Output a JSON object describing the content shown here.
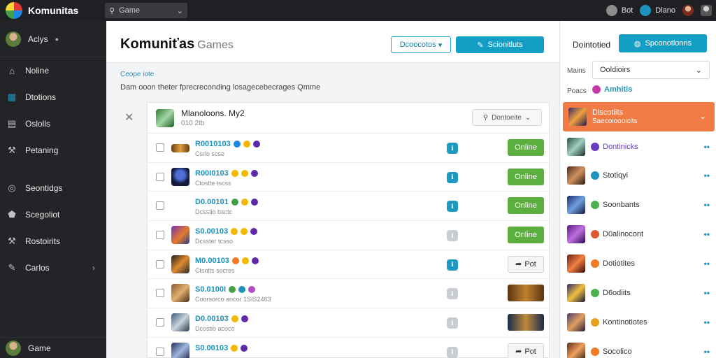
{
  "app": {
    "title": "Komunitas"
  },
  "search": {
    "value": "Game"
  },
  "topbar": {
    "items": [
      {
        "label": "Bot",
        "icon": "headset-icon",
        "color": "#8d8d8d"
      },
      {
        "label": "Dlano",
        "icon": "globe-icon",
        "color": "#1e94bd"
      }
    ]
  },
  "sidebar": {
    "user": "Aclys",
    "items": [
      {
        "label": "Noline",
        "icon": "home-icon"
      },
      {
        "label": "Dtotions",
        "icon": "users-icon"
      },
      {
        "label": "Oslolls",
        "icon": "chat-icon"
      },
      {
        "label": "Petaning",
        "icon": "wrench-icon"
      },
      {
        "label": "Seontidgs",
        "icon": "gauge-icon"
      },
      {
        "label": "Scegoliot",
        "icon": "shield-icon"
      },
      {
        "label": "Rostoirits",
        "icon": "wrench-icon"
      },
      {
        "label": "Carlos",
        "icon": "tool-icon"
      }
    ],
    "bottom_label": "Game"
  },
  "header": {
    "title": "Komuniťas",
    "subtitle": "Games",
    "outline_button": "Dcoocotos",
    "primary_button": "Scionitluts"
  },
  "breadcrumb": "Ceope iote",
  "description": "Dam ooon theter fprecreconding losagecebecrages Qmme",
  "table": {
    "header": {
      "title": "Mlanoloons. My2",
      "subtitle": "010 2tb",
      "filter_label": "Dontoeite"
    },
    "rows": [
      {
        "name": "R0010103",
        "sub": "Csrlo scse",
        "status": "Online",
        "status_type": "online",
        "pill_color": "#1e9ac2"
      },
      {
        "name": "R00I0103",
        "sub": "Ctostte tscss",
        "status": "Online",
        "status_type": "online",
        "pill_color": "#1e9ac2"
      },
      {
        "name": "D0.00101",
        "sub": "Dcsstio bsctc",
        "status": "Online",
        "status_type": "online",
        "pill_color": "#1e9ac2"
      },
      {
        "name": "S0.00103",
        "sub": "Dcsster tcsso",
        "status": "Online",
        "status_type": "online",
        "pill_color": "#c9cdd2"
      },
      {
        "name": "M0.00103",
        "sub": "Ctsnlts socres",
        "status": "Pot",
        "status_type": "post",
        "pill_color": "#1e9ac2"
      },
      {
        "name": "S0.0100I",
        "sub": "Coorsorco ancor 1SIS2463",
        "status": "banner",
        "status_type": "banner",
        "pill_color": "#c9cdd2"
      },
      {
        "name": "D0.00103",
        "sub": "Dcostio acoco",
        "status": "banner",
        "status_type": "banner",
        "pill_color": "#c9cdd2"
      },
      {
        "name": "S0.00103",
        "sub": "",
        "status": "Pot",
        "status_type": "post",
        "pill_color": "#c9cdd2"
      }
    ]
  },
  "right_panel": {
    "header": "Dointotied",
    "button": "Spconotlonns",
    "label_main": "Mains",
    "select_value": "Ooldioirs",
    "label_filter": "Poacs",
    "filter_value": "Amhitis",
    "active": {
      "title": "Dlscotiits",
      "subtitle": "Saecoioooicits"
    },
    "items": [
      {
        "label": "Dontinicks",
        "icon_color": "#6a3cc4"
      },
      {
        "label": "Stotiqyi",
        "icon_color": "#1e94bd"
      },
      {
        "label": "Soonbants",
        "icon_color": "#4caf50"
      },
      {
        "label": "D0alinocont",
        "icon_color": "#e0582f"
      },
      {
        "label": "Dotiotites",
        "icon_color": "#f07b20"
      },
      {
        "label": "D6odiits",
        "icon_color": "#4caf50"
      },
      {
        "label": "Kontinotiotes",
        "icon_color": "#e5a21d"
      },
      {
        "label": "Socolico",
        "icon_color": "#f07b20"
      }
    ]
  },
  "colors": {
    "accent": "#139ec4",
    "online": "#5cae3e",
    "highlight": "#f07b45",
    "sidebar": "#232427"
  }
}
